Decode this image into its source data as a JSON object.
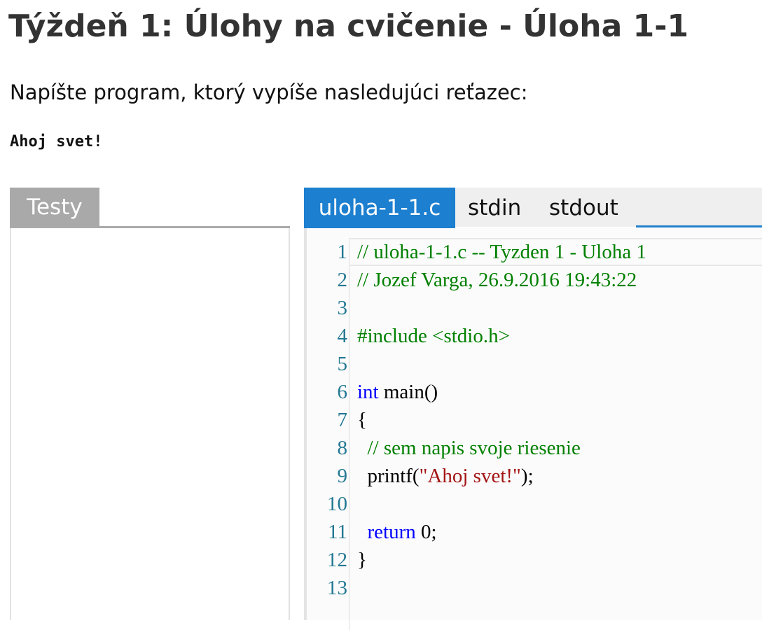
{
  "page_title": "Týždeň 1: Úlohy na cvičenie - Úloha 1-1",
  "assignment_text": "Napíšte program, ktorý vypíše nasledujúci reťazec:",
  "expected_output": "Ahoj svet!",
  "tests_panel": {
    "tab_label": "Testy"
  },
  "editor": {
    "tabs": [
      {
        "label": "uloha-1-1.c",
        "active": true
      },
      {
        "label": "stdin",
        "active": false
      },
      {
        "label": "stdout",
        "active": false
      }
    ],
    "line_numbers": [
      "1",
      "2",
      "3",
      "4",
      "5",
      "6",
      "7",
      "8",
      "9",
      "10",
      "11",
      "12",
      "13"
    ],
    "lines": [
      [
        {
          "t": "// uloha-1-1.c -- Tyzden 1 - Uloha 1",
          "k": "comment"
        }
      ],
      [
        {
          "t": "// Jozef Varga, 26.9.2016 19:43:22",
          "k": "comment"
        }
      ],
      [],
      [
        {
          "t": "#include <stdio.h>",
          "k": "pre"
        }
      ],
      [],
      [
        {
          "t": "int",
          "k": "kw"
        },
        {
          "t": " main()",
          "k": "plain"
        }
      ],
      [
        {
          "t": "{",
          "k": "plain"
        }
      ],
      [
        {
          "t": "  ",
          "k": "plain"
        },
        {
          "t": "// sem napis svoje riesenie",
          "k": "comment"
        }
      ],
      [
        {
          "t": "  printf(",
          "k": "plain"
        },
        {
          "t": "\"Ahoj svet!\"",
          "k": "str"
        },
        {
          "t": ");",
          "k": "plain"
        }
      ],
      [],
      [
        {
          "t": "  ",
          "k": "plain"
        },
        {
          "t": "return",
          "k": "kw"
        },
        {
          "t": " 0;",
          "k": "plain"
        }
      ],
      [
        {
          "t": "}",
          "k": "plain"
        }
      ],
      []
    ]
  },
  "colors": {
    "active_tab": "#1d7fcf",
    "tests_tab": "#a9a9a9",
    "comment": "#008000",
    "keyword": "#0000ff",
    "string": "#a31515",
    "line_number": "#237893"
  }
}
